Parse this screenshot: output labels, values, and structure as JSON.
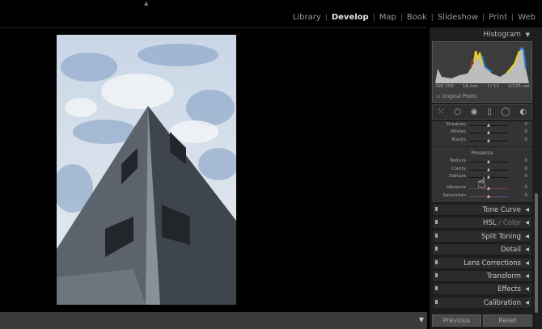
{
  "modules": {
    "items": [
      "Library",
      "Develop",
      "Map",
      "Book",
      "Slideshow",
      "Print",
      "Web"
    ],
    "active": "Develop"
  },
  "histogram": {
    "title": "Histogram",
    "iso": "ISO 100",
    "focal": "16 mm",
    "aperture": "f / 11",
    "shutter": "1/125 sec",
    "original_photo": "Original Photo"
  },
  "basic": {
    "tone_rows": [
      {
        "label": "Shadows",
        "value": "0"
      },
      {
        "label": "Whites",
        "value": "0"
      },
      {
        "label": "Blacks",
        "value": "0"
      }
    ],
    "presence_title": "Presence",
    "presence_rows": [
      {
        "label": "Texture",
        "value": "0"
      },
      {
        "label": "Clarity",
        "value": "0"
      },
      {
        "label": "Dehaze",
        "value": "0"
      },
      {
        "label": "Vibrance",
        "value": "0"
      },
      {
        "label": "Saturation",
        "value": "0"
      }
    ]
  },
  "panels": {
    "tone_curve": "Tone Curve",
    "hsl": "HSL",
    "hsl_sep": " / ",
    "color": "Color",
    "split_toning": "Split Toning",
    "detail": "Detail",
    "lens": "Lens Corrections",
    "transform": "Transform",
    "effects": "Effects",
    "calibration": "Calibration"
  },
  "buttons": {
    "previous": "Previous",
    "reset": "Reset"
  }
}
